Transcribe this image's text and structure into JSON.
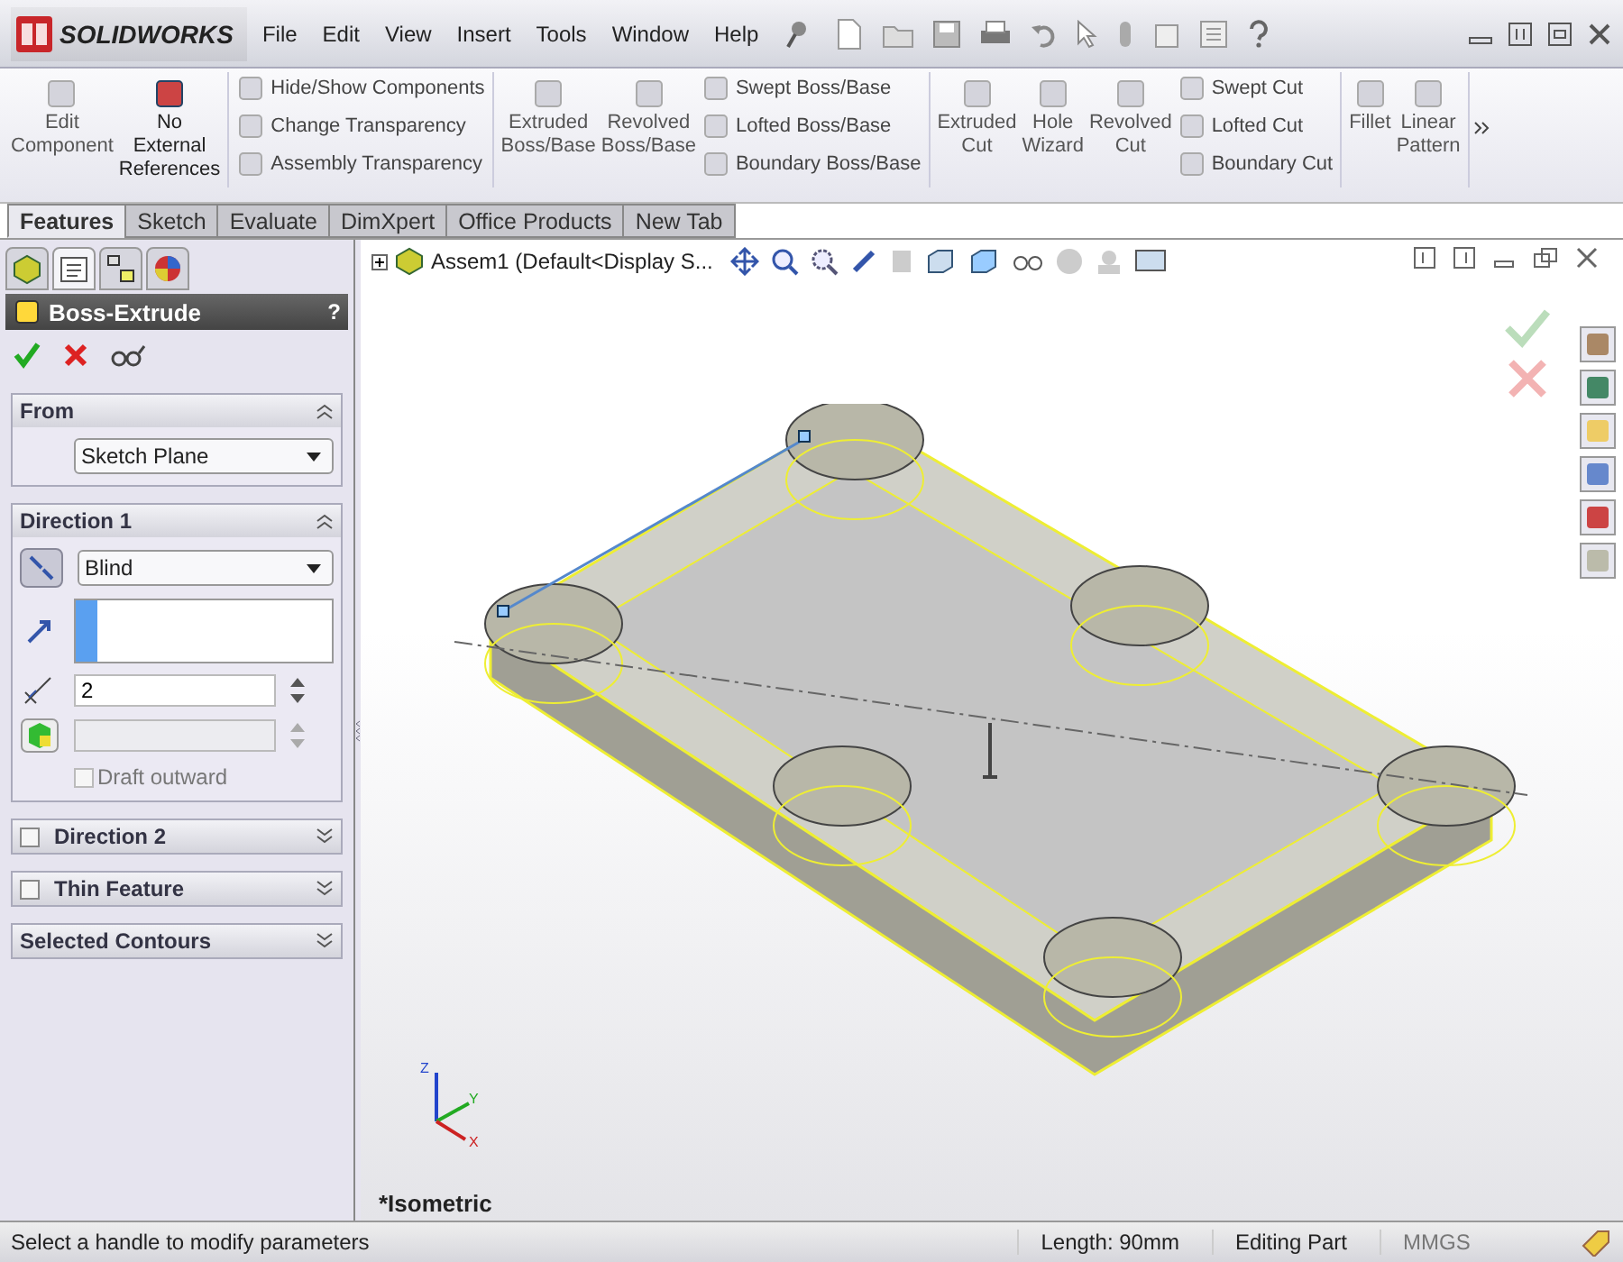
{
  "app": {
    "logo_text": "SOLIDWORKS"
  },
  "menu": [
    "File",
    "Edit",
    "View",
    "Insert",
    "Tools",
    "Window",
    "Help"
  ],
  "ribbon": {
    "groups": [
      {
        "items": [
          {
            "kind": "large",
            "label": "Edit\nComponent",
            "disabled": true
          },
          {
            "kind": "large",
            "label": "No\nExternal\nReferences",
            "disabled": false
          }
        ]
      },
      {
        "items": [
          {
            "kind": "stack",
            "labels": [
              "Hide/Show Components",
              "Change Transparency",
              "Assembly Transparency"
            ]
          }
        ]
      },
      {
        "items": [
          {
            "kind": "large",
            "label": "Extruded\nBoss/Base",
            "disabled": true
          },
          {
            "kind": "large",
            "label": "Revolved\nBoss/Base",
            "disabled": true
          },
          {
            "kind": "stack",
            "labels": [
              "Swept Boss/Base",
              "Lofted Boss/Base",
              "Boundary Boss/Base"
            ]
          }
        ]
      },
      {
        "items": [
          {
            "kind": "large",
            "label": "Extruded\nCut",
            "disabled": true
          },
          {
            "kind": "large",
            "label": "Hole\nWizard",
            "disabled": true
          },
          {
            "kind": "large",
            "label": "Revolved\nCut",
            "disabled": true
          },
          {
            "kind": "stack",
            "labels": [
              "Swept Cut",
              "Lofted Cut",
              "Boundary Cut"
            ]
          }
        ]
      },
      {
        "items": [
          {
            "kind": "large",
            "label": "Fillet",
            "disabled": true
          },
          {
            "kind": "large",
            "label": "Linear\nPattern",
            "disabled": true
          }
        ]
      }
    ]
  },
  "tabs": [
    {
      "label": "Features",
      "selected": true
    },
    {
      "label": "Sketch",
      "selected": false
    },
    {
      "label": "Evaluate",
      "selected": false
    },
    {
      "label": "DimXpert",
      "selected": false
    },
    {
      "label": "Office Products",
      "selected": false
    },
    {
      "label": "New Tab",
      "selected": false
    }
  ],
  "panel_tabs": [
    {
      "selected": false
    },
    {
      "selected": true
    },
    {
      "selected": false
    },
    {
      "selected": false
    }
  ],
  "property_manager": {
    "title": "Boss-Extrude",
    "help": "?",
    "sections": [
      {
        "kind": "from",
        "title": "From",
        "expanded": true,
        "select": "Sketch Plane"
      },
      {
        "kind": "direction",
        "title": "Direction 1",
        "expanded": true,
        "select": "Blind",
        "depth": "2",
        "draft": {
          "label": "Draft outward",
          "checked": false
        }
      },
      {
        "kind": "check",
        "title": "Direction 2",
        "expanded": false,
        "checked": false
      },
      {
        "kind": "check",
        "title": "Thin Feature",
        "expanded": false,
        "checked": false
      },
      {
        "kind": "plain",
        "title": "Selected Contours",
        "expanded": false
      }
    ]
  },
  "viewport": {
    "tree_item": "Assem1  (Default<Display S...",
    "view_label": "*Isometric",
    "triad_labels": [
      "Z",
      "Y",
      "X"
    ]
  },
  "status_bar": {
    "message": "Select a handle to modify parameters",
    "length": "Length: 90mm",
    "mode": "Editing Part",
    "units": "MMGS"
  }
}
